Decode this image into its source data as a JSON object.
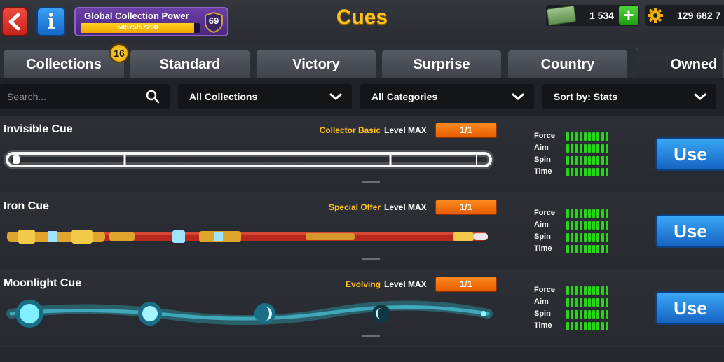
{
  "header": {
    "title": "Cues",
    "collection_power": {
      "label": "Global Collection Power",
      "progress_text": "54575/57200",
      "progress_fraction": 0.954,
      "level": "69"
    },
    "cash": "1 534",
    "coins": "129 682 7",
    "icons": [
      "back-arrow-icon",
      "info-icon",
      "cash-icon",
      "plus-icon",
      "coin-gear-icon"
    ]
  },
  "tabs": [
    {
      "label": "Collections",
      "badge": "16"
    },
    {
      "label": "Standard"
    },
    {
      "label": "Victory"
    },
    {
      "label": "Surprise"
    },
    {
      "label": "Country"
    },
    {
      "label": "Owned",
      "active": true
    }
  ],
  "filters": {
    "search_placeholder": "Search...",
    "collections": "All Collections",
    "categories": "All Categories",
    "sort": "Sort by: Stats"
  },
  "stat_labels": [
    "Force",
    "Aim",
    "Spin",
    "Time"
  ],
  "cues": [
    {
      "name": "Invisible Cue",
      "source": "Collector Basic",
      "level_label": "Level MAX",
      "count": "1/1",
      "use_label": "Use",
      "stats": [
        10,
        10,
        10,
        10
      ],
      "style": "invisible"
    },
    {
      "name": "Iron Cue",
      "source": "Special Offer",
      "level_label": "Level MAX",
      "count": "1/1",
      "use_label": "Use",
      "stats": [
        10,
        10,
        10,
        10
      ],
      "style": "iron"
    },
    {
      "name": "Moonlight Cue",
      "source": "Evolving",
      "level_label": "Level MAX",
      "count": "1/1",
      "use_label": "Use",
      "stats": [
        10,
        10,
        10,
        10
      ],
      "style": "moonlight"
    }
  ],
  "colors": {
    "accent_yellow": "#ffc21b",
    "stat_green": "#27d619",
    "use_blue": "#1f7fdc",
    "pill_orange": "#f07110"
  }
}
